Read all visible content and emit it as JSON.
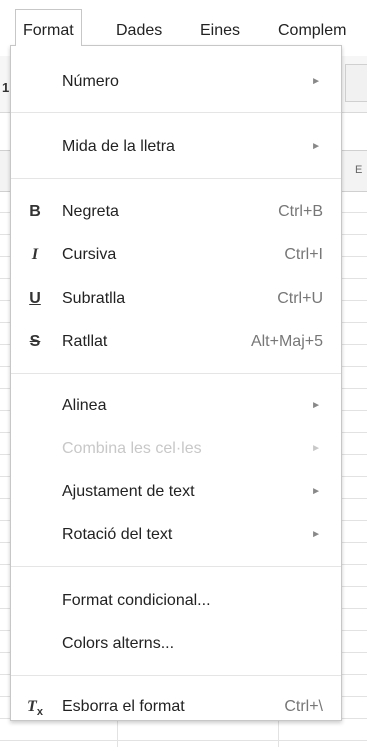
{
  "menubar": {
    "items": [
      "Format",
      "Dades",
      "Eines",
      "Complem"
    ]
  },
  "background": {
    "row_number": "1",
    "column_letter": "E"
  },
  "format_menu": {
    "numero": {
      "label": "Número",
      "arrow": "►"
    },
    "mida": {
      "label": "Mida de la lletra",
      "arrow": "►"
    },
    "negreta": {
      "icon": "B",
      "label": "Negreta",
      "shortcut": "Ctrl+B"
    },
    "cursiva": {
      "icon": "I",
      "label": "Cursiva",
      "shortcut": "Ctrl+I"
    },
    "subratlla": {
      "icon": "U",
      "label": "Subratlla",
      "shortcut": "Ctrl+U"
    },
    "ratllat": {
      "icon": "S",
      "label": "Ratllat",
      "shortcut": "Alt+Maj+5"
    },
    "alinea": {
      "label": "Alinea",
      "arrow": "►"
    },
    "combina": {
      "label": "Combina les cel·les",
      "arrow": "►"
    },
    "ajustament": {
      "label": "Ajustament de text",
      "arrow": "►"
    },
    "rotacio": {
      "label": "Rotació del text",
      "arrow": "►"
    },
    "condicional": {
      "label": "Format condicional..."
    },
    "colors": {
      "label": "Colors alterns..."
    },
    "esborra": {
      "icon": "T",
      "icon_sub": "x",
      "label": "Esborra el format",
      "shortcut": "Ctrl+\\"
    }
  }
}
